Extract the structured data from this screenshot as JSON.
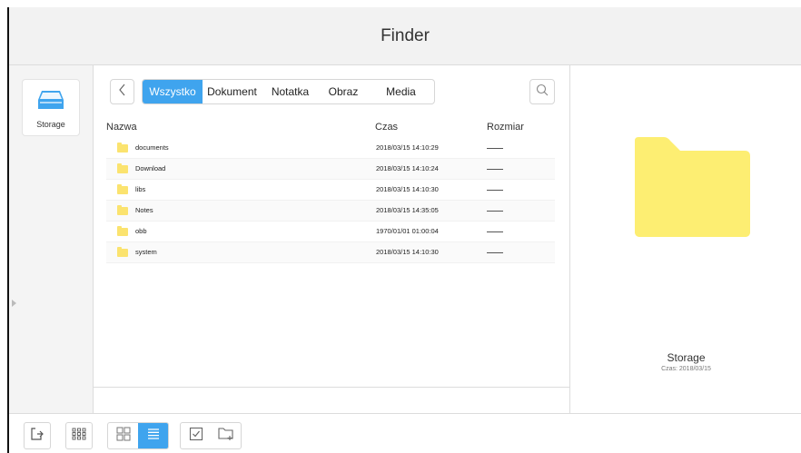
{
  "window": {
    "title": "Finder"
  },
  "sidebar": {
    "storage_label": "Storage"
  },
  "toolbar": {
    "tabs": [
      {
        "label": "Wszystko",
        "active": true
      },
      {
        "label": "Dokument",
        "active": false
      },
      {
        "label": "Notatka",
        "active": false
      },
      {
        "label": "Obraz",
        "active": false
      },
      {
        "label": "Media",
        "active": false
      }
    ]
  },
  "list": {
    "columns": {
      "name": "Nazwa",
      "time": "Czas",
      "size": "Rozmiar"
    },
    "rows": [
      {
        "name": "documents",
        "time": "2018/03/15 14:10:29",
        "size": "—"
      },
      {
        "name": "Download",
        "time": "2018/03/15 14:10:24",
        "size": "—"
      },
      {
        "name": "libs",
        "time": "2018/03/15 14:10:30",
        "size": "—"
      },
      {
        "name": "Notes",
        "time": "2018/03/15 14:35:05",
        "size": "—"
      },
      {
        "name": "obb",
        "time": "1970/01/01 01:00:04",
        "size": "—"
      },
      {
        "name": "system",
        "time": "2018/03/15 14:10:30",
        "size": "—"
      }
    ]
  },
  "preview": {
    "name": "Storage",
    "meta": "Czas: 2018/03/15"
  },
  "colors": {
    "accent": "#3fa4ee",
    "folder": "#fbe36f",
    "storage_icon": "#3fa4ee"
  },
  "icons": {
    "back": "chevron-left-icon",
    "search": "search-icon",
    "storage": "storage-drive-icon",
    "exit": "exit-icon",
    "apps": "apps-grid-icon",
    "grid_view": "grid-view-icon",
    "list_view": "list-view-icon",
    "select": "checkbox-icon",
    "new_folder": "new-folder-icon"
  },
  "bottom": {
    "view_mode": "list"
  }
}
